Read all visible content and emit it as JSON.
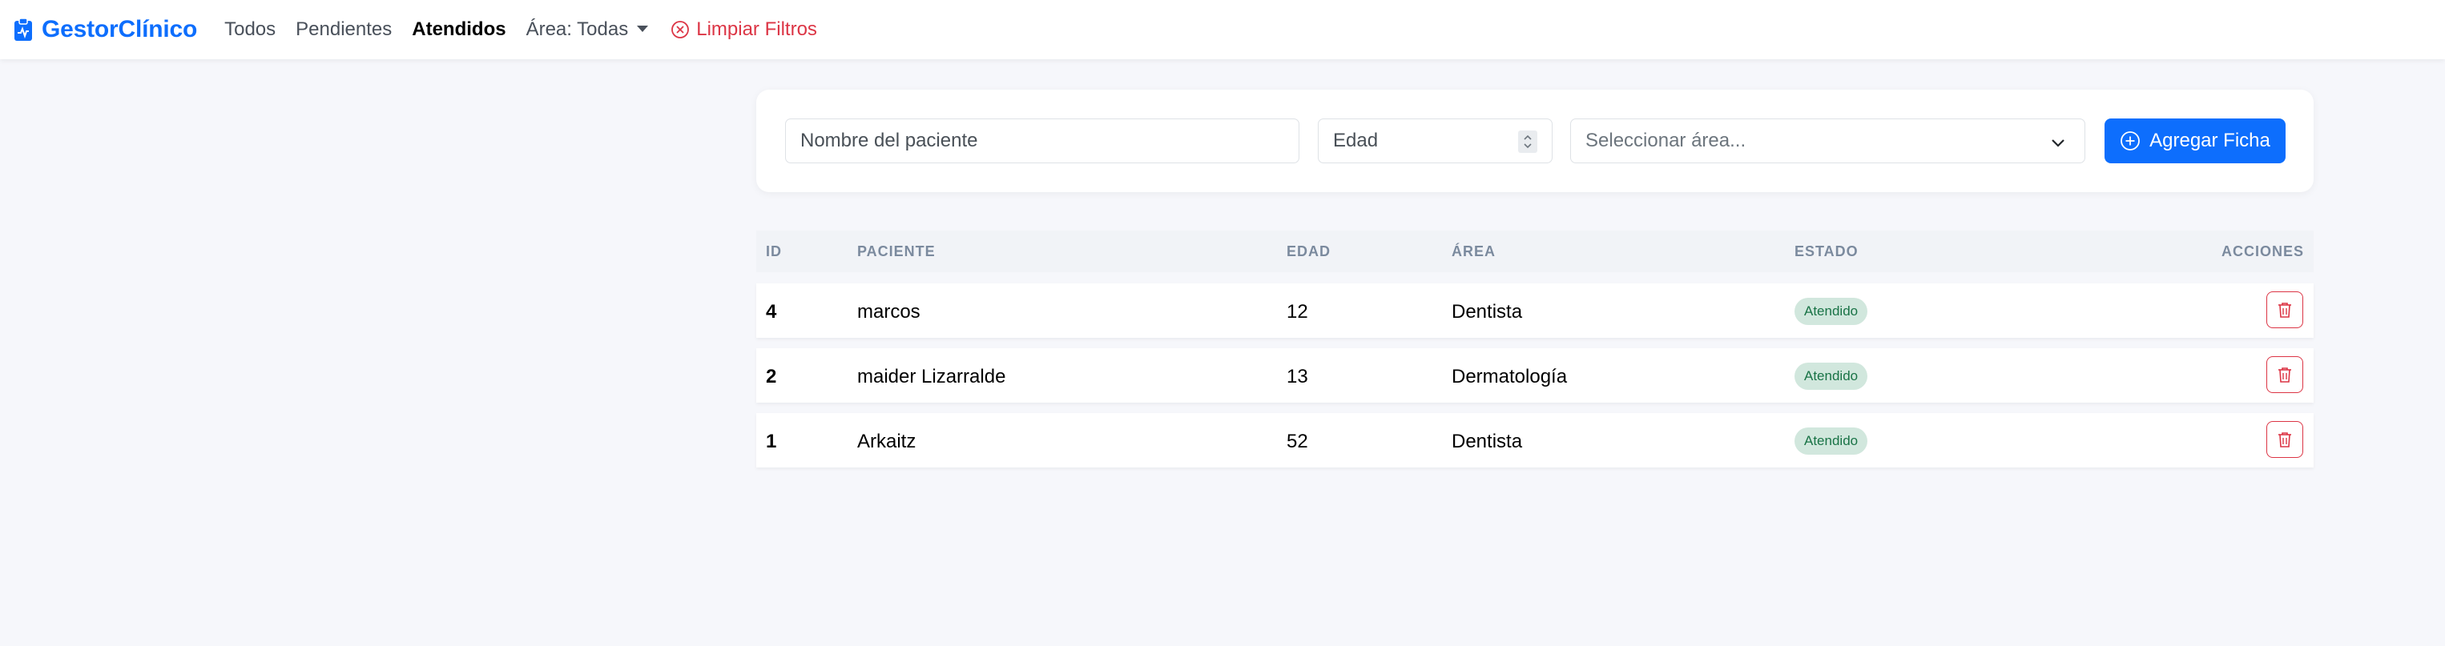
{
  "navbar": {
    "brand": "GestorClínico",
    "links": {
      "all": "Todos",
      "pending": "Pendientes",
      "attended": "Atendidos"
    },
    "area_dropdown": "Área: Todas",
    "clear_filters": "Limpiar Filtros"
  },
  "form": {
    "name_placeholder": "Nombre del paciente",
    "age_placeholder": "Edad",
    "area_placeholder": "Seleccionar área...",
    "add_button": "Agregar Ficha"
  },
  "table": {
    "headers": {
      "id": "ID",
      "patient": "PACIENTE",
      "age": "EDAD",
      "area": "ÁREA",
      "status": "ESTADO",
      "actions": "ACCIONES"
    },
    "rows": [
      {
        "id": "4",
        "patient": "marcos",
        "age": "12",
        "area": "Dentista",
        "status": "Atendido"
      },
      {
        "id": "2",
        "patient": "maider Lizarralde",
        "age": "13",
        "area": "Dermatología",
        "status": "Atendido"
      },
      {
        "id": "1",
        "patient": "Arkaitz",
        "age": "52",
        "area": "Dentista",
        "status": "Atendido"
      }
    ]
  },
  "colors": {
    "primary": "#0d6efd",
    "danger": "#dc3545",
    "success_bg": "#d1e7dd",
    "success_text": "#197346",
    "page_bg": "#f6f7fb"
  },
  "icons": {
    "brand": "clipboard-pulse-icon",
    "clear": "x-circle-icon",
    "add": "plus-circle-icon",
    "delete": "trash-icon",
    "select": "chevron-down-icon",
    "spinner": "spin-arrows-icon"
  }
}
